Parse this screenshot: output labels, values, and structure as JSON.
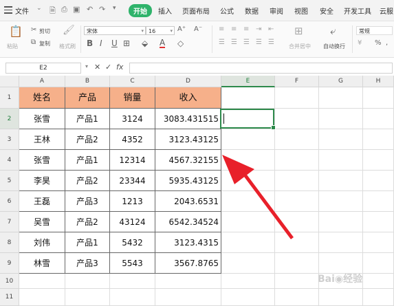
{
  "menubar": {
    "file_label": "文件",
    "items": [
      "开始",
      "插入",
      "页面布局",
      "公式",
      "数据",
      "审阅",
      "视图",
      "安全",
      "开发工具",
      "云服"
    ]
  },
  "ribbon": {
    "paste_label": "粘贴",
    "cut_label": "剪切",
    "copy_label": "复制",
    "format_painter_label": "格式刷",
    "font_name": "宋体",
    "font_size": "16",
    "merge_label": "合并居中",
    "wrap_label": "自动换行",
    "number_format": "常规"
  },
  "formula_bar": {
    "name_box": "E2",
    "fx_label": "fx",
    "content": ""
  },
  "sheet": {
    "columns": [
      "A",
      "B",
      "C",
      "D",
      "E",
      "F",
      "G",
      "H"
    ],
    "row_numbers": [
      "1",
      "2",
      "3",
      "4",
      "5",
      "6",
      "7",
      "8",
      "9",
      "10",
      "11"
    ],
    "headers": [
      "姓名",
      "产品",
      "销量",
      "收入"
    ],
    "rows": [
      [
        "张雪",
        "产品1",
        "3124",
        "3083.431515"
      ],
      [
        "王林",
        "产品2",
        "4352",
        "3123.43125"
      ],
      [
        "张雪",
        "产品1",
        "12314",
        "4567.32155"
      ],
      [
        "李昊",
        "产品2",
        "23344",
        "5935.43125"
      ],
      [
        "王磊",
        "产品3",
        "1213",
        "2043.6531"
      ],
      [
        "吴雪",
        "产品2",
        "43124",
        "6542.34524"
      ],
      [
        "刘伟",
        "产品1",
        "5432",
        "3123.4315"
      ],
      [
        "林雪",
        "产品3",
        "5543",
        "3567.8765"
      ]
    ],
    "selected_cell": "E2"
  },
  "colors": {
    "header_fill": "#f6b08a",
    "accent_green": "#2d8a4b",
    "arrow_red": "#e8202a"
  },
  "icons": [
    "hamburger-icon",
    "save-icon",
    "print-icon",
    "undo-icon",
    "redo-icon",
    "cut-icon",
    "copy-icon",
    "bold-icon",
    "italic-icon",
    "underline-icon",
    "cancel-icon",
    "confirm-icon",
    "function-icon",
    "red-arrow-annotation"
  ]
}
